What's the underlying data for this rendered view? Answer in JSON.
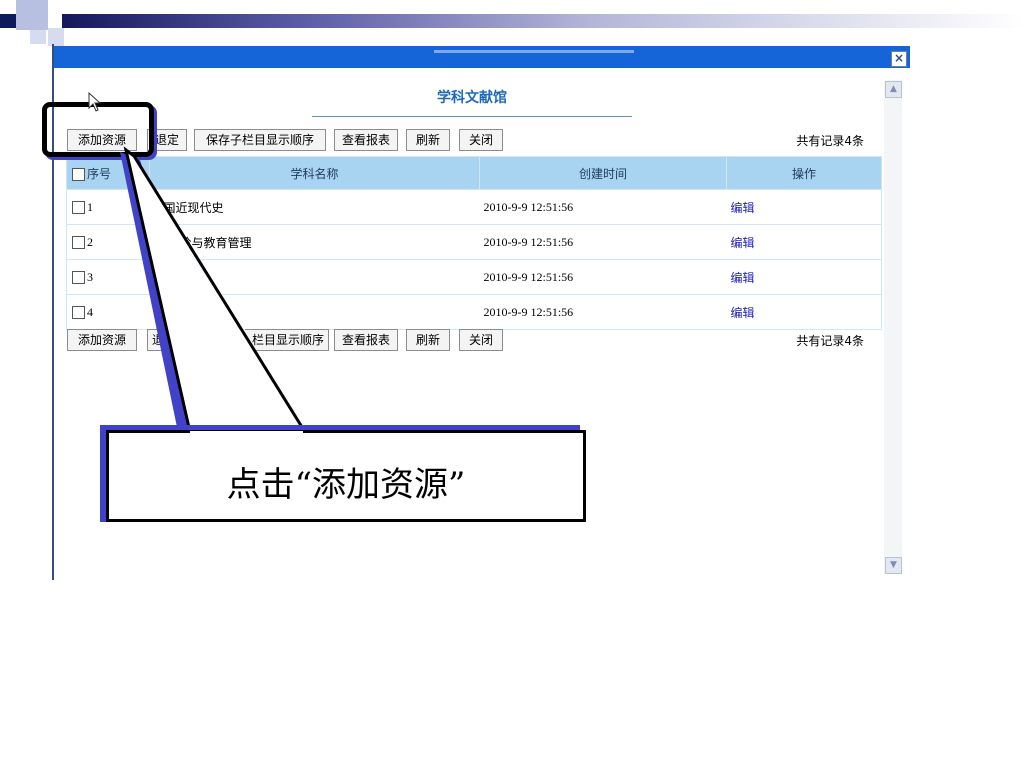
{
  "window": {
    "title_blurred": "",
    "close_icon": "close-icon",
    "scroll_up_icon": "scroll-up-icon",
    "scroll_down_icon": "scroll-down-icon",
    "accent_color": "#1565d8"
  },
  "page": {
    "title": "学科文献馆"
  },
  "toolbar_top": {
    "add_resource": "添加资源",
    "confirm": "退定",
    "save_order": "保存子栏目显示顺序",
    "view_report": "查看报表",
    "refresh": "刷新",
    "close": "关闭",
    "record_count": "共有记录4条"
  },
  "toolbar_bottom": {
    "add_resource": "添加资源",
    "confirm": "退",
    "save_order": "栏目显示顺序",
    "view_report": "查看报表",
    "refresh": "刷新",
    "close": "关闭",
    "record_count": "共有记录4条"
  },
  "table": {
    "headers": {
      "seq": "序号",
      "name": "学科名称",
      "created": "创建时间",
      "action": "操作"
    },
    "header_color": "#a8d3f1",
    "rows": [
      {
        "seq": "1",
        "name": "中国近现代史",
        "created": "2010-9-9 12:51:56",
        "action": "编辑"
      },
      {
        "seq": "2",
        "name": "理论与教育管理",
        "created": "2010-9-9 12:51:56",
        "action": "编辑"
      },
      {
        "seq": "3",
        "name": "",
        "created": "2010-9-9 12:51:56",
        "action": "编辑"
      },
      {
        "seq": "4",
        "name": "",
        "created": "2010-9-9 12:51:56",
        "action": "编辑"
      }
    ]
  },
  "annotation": {
    "callout_text": "点击“添加资源”",
    "cursor_icon": "mouse-pointer-icon"
  }
}
